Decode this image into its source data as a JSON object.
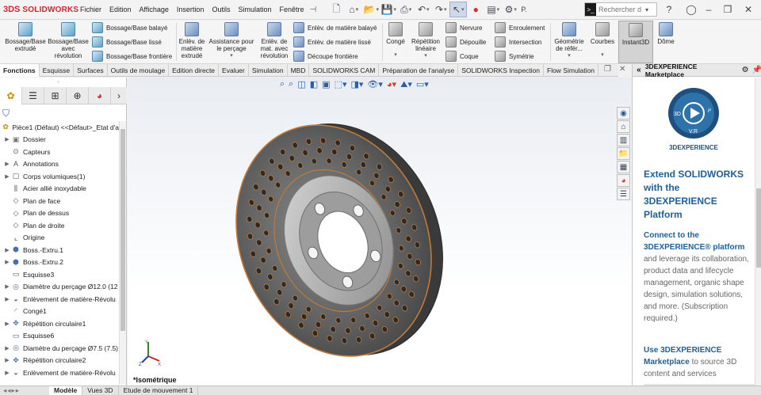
{
  "app": {
    "logo_ds": "3DS",
    "logo_text": "SOLIDWORKS"
  },
  "menu": [
    "Fichier",
    "Edition",
    "Affichage",
    "Insertion",
    "Outils",
    "Simulation",
    "Fenêtre"
  ],
  "search": {
    "placeholder": "Rechercher d"
  },
  "ribbon": {
    "features": [
      {
        "label": "Bossage/Base extrudé"
      },
      {
        "label": "Bossage/Base avec révolution"
      },
      {
        "label": "Enlèv. de matière extrudé"
      },
      {
        "label": "Assistance pour le perçage"
      },
      {
        "label": "Enlèv. de mat. avec révolution"
      }
    ],
    "boss_small": [
      "Bossage/Base balayé",
      "Bossage/Base lissé",
      "Bossage/Base frontière"
    ],
    "cut_small": [
      "Enlèv. de matière balayé",
      "Enlèv. de matière lissé",
      "Découpe frontière"
    ],
    "conge": "Congé",
    "repetition": "Répétition linéaire",
    "col3": [
      "Nervure",
      "Dépouille",
      "Coque"
    ],
    "col4": [
      "Enroulement",
      "Intersection",
      "Symétrie"
    ],
    "geometry": "Géométrie de référ...",
    "courbes": "Courbes",
    "instant3d": "Instant3D",
    "dome": "Dôme"
  },
  "tabs": [
    "Fonctions",
    "Esquisse",
    "Surfaces",
    "Outils de moulage",
    "Edition directe",
    "Evaluer",
    "Simulation",
    "MBD",
    "SOLIDWORKS CAM",
    "Préparation de l'analyse",
    "SOLIDWORKS Inspection",
    "Flow Simulation"
  ],
  "tree": [
    {
      "label": "Pièce1 (Défaut) <<Défaut>_Etat d'a",
      "arrow": "",
      "icon": "part",
      "indent": 0
    },
    {
      "label": "Dossier",
      "arrow": "▶",
      "icon": "folder",
      "indent": 1
    },
    {
      "label": "Capteurs",
      "arrow": "",
      "icon": "sensor",
      "indent": 1
    },
    {
      "label": "Annotations",
      "arrow": "▶",
      "icon": "annot",
      "indent": 1
    },
    {
      "label": "Corps volumiques(1)",
      "arrow": "▶",
      "icon": "body",
      "indent": 1
    },
    {
      "label": "Acier allié inoxydable",
      "arrow": "",
      "icon": "material",
      "indent": 1
    },
    {
      "label": "Plan de face",
      "arrow": "",
      "icon": "plane",
      "indent": 1
    },
    {
      "label": "Plan de dessus",
      "arrow": "",
      "icon": "plane",
      "indent": 1
    },
    {
      "label": "Plan de droite",
      "arrow": "",
      "icon": "plane",
      "indent": 1
    },
    {
      "label": "Origine",
      "arrow": "",
      "icon": "origin",
      "indent": 1
    },
    {
      "label": "Boss.-Extru.1",
      "arrow": "▶",
      "icon": "feature",
      "indent": 1
    },
    {
      "label": "Boss.-Extru.2",
      "arrow": "▶",
      "icon": "feature",
      "indent": 1
    },
    {
      "label": "Esquisse3",
      "arrow": "",
      "icon": "sketch",
      "indent": 1
    },
    {
      "label": "Diamètre du perçage Ø12.0 (12",
      "arrow": "▶",
      "icon": "hole",
      "indent": 1
    },
    {
      "label": "Enlèvement de matière-Révolu",
      "arrow": "▶",
      "icon": "cut",
      "indent": 1
    },
    {
      "label": "Congé1",
      "arrow": "",
      "icon": "fillet",
      "indent": 1
    },
    {
      "label": "Répétition circulaire1",
      "arrow": "▶",
      "icon": "pattern",
      "indent": 1
    },
    {
      "label": "Esquisse6",
      "arrow": "",
      "icon": "sketch",
      "indent": 1
    },
    {
      "label": "Diamètre du perçage Ø7.5 (7.5)",
      "arrow": "▶",
      "icon": "hole",
      "indent": 1
    },
    {
      "label": "Répétition circulaire2",
      "arrow": "▶",
      "icon": "pattern",
      "indent": 1
    },
    {
      "label": "Enlèvement de matière-Révolu",
      "arrow": "▶",
      "icon": "cut",
      "indent": 1
    }
  ],
  "bottom_tabs": [
    "Modèle",
    "Vues 3D",
    "Etude de mouvement 1"
  ],
  "viewport": {
    "view_label": "*Isométrique"
  },
  "taskpane": {
    "title": "3DEXPERIENCE Marketplace",
    "brand_caption": "3DEXPERIENCE",
    "heading": "Extend SOLIDWORKS with the 3DEXPERIENCE Platform",
    "p1_lead": "Connect to the 3DEXPERIENCE® platform",
    "p1_rest": " and leverage its collaboration, product data and lifecycle management, organic shape design, simulation solutions, and more. (Subscription required.)",
    "p2_lead": "Use 3DEXPERIENCE Marketplace",
    "p2_rest": " to source 3D content and services"
  },
  "colors": {
    "accent": "#1f5f99",
    "brand_red": "#d5232f",
    "disc_rim": "#c07a3a"
  }
}
